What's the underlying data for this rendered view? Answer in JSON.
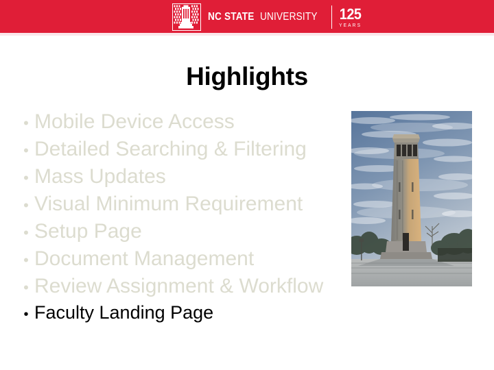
{
  "header": {
    "brand": {
      "mark_icon": "nc-state-brick-logo-icon",
      "name_bold": "NC STATE",
      "name_regular": " UNIVERSITY",
      "anniversary_number": "125",
      "anniversary_label": "YEARS"
    },
    "background_color": "#e01e37"
  },
  "slide": {
    "title": "Highlights",
    "title_color": "#000000",
    "dim_color": "#dcdccf",
    "active_color": "#000000",
    "bullet_glyph": "•",
    "items": [
      {
        "label": "Mobile Device Access",
        "state": "dim"
      },
      {
        "label": "Detailed Searching & Filtering",
        "state": "dim"
      },
      {
        "label": "Mass Updates",
        "state": "dim"
      },
      {
        "label": "Visual Minimum Requirement",
        "state": "dim"
      },
      {
        "label": "Setup Page",
        "state": "dim"
      },
      {
        "label": "Document Management",
        "state": "dim"
      },
      {
        "label": "Review Assignment & Workflow",
        "state": "dim"
      },
      {
        "label": "Faculty Landing Page",
        "state": "active"
      }
    ]
  },
  "media": {
    "photo_name": "nc-state-memorial-belltower-photo"
  }
}
